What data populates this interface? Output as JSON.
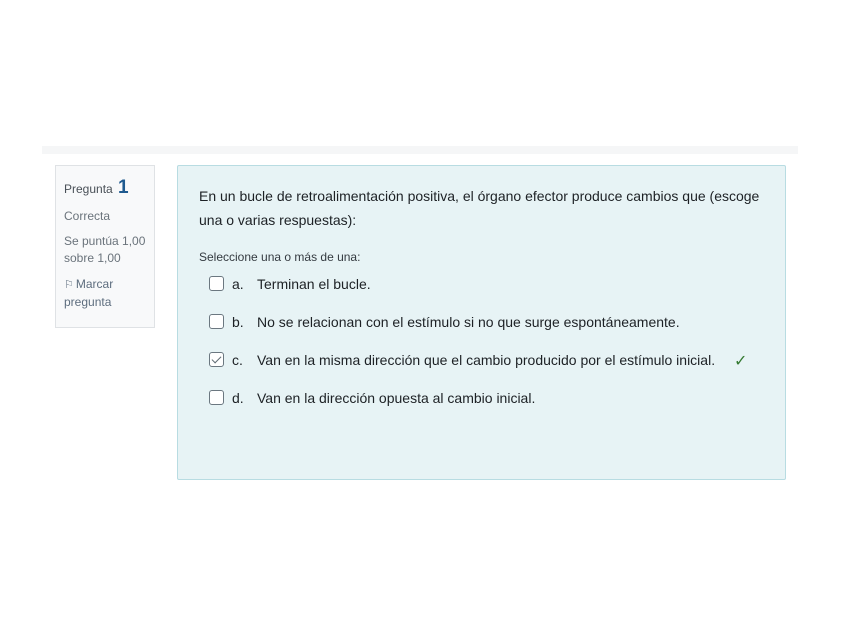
{
  "info": {
    "question_label": "Pregunta",
    "question_number": "1",
    "state": "Correcta",
    "grade": "Se puntúa 1,00 sobre 1,00",
    "flag_label": "Marcar pregunta"
  },
  "question": {
    "text": "En un bucle de retroalimentación positiva, el órgano efector produce cambios que (escoge una o varias respuestas):",
    "prompt": "Seleccione una o más de una:"
  },
  "answers": [
    {
      "letter": "a.",
      "text": "Terminan el bucle.",
      "checked": false
    },
    {
      "letter": "b.",
      "text": "No se relacionan con el estímulo si no que surge espontáneamente.",
      "checked": false
    },
    {
      "letter": "c.",
      "text": "Van en la misma dirección que el cambio producido por el estímulo inicial.",
      "checked": true,
      "correct_mark": "✓"
    },
    {
      "letter": "d.",
      "text": "Van en la dirección opuesta al cambio inicial.",
      "checked": false
    }
  ]
}
